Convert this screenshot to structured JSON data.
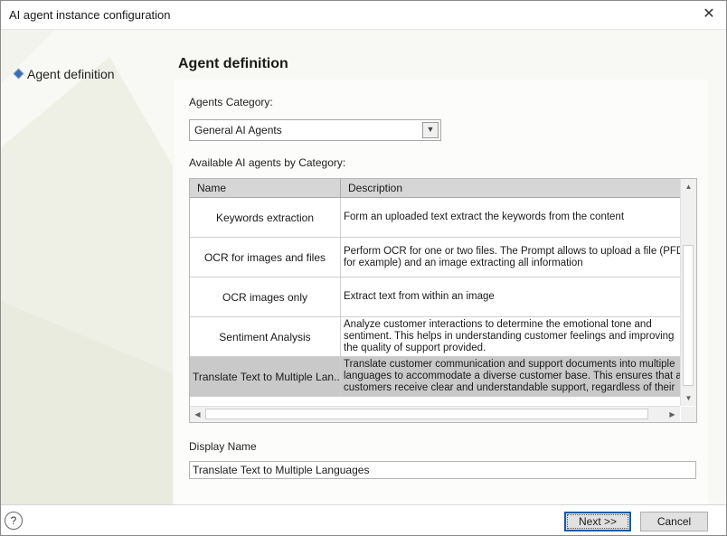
{
  "window": {
    "title": "AI agent instance configuration",
    "close_icon": "close-icon"
  },
  "nav": {
    "items": [
      {
        "label": "Agent definition",
        "icon": "diamond-bullet-icon"
      }
    ]
  },
  "main": {
    "section_title": "Agent definition",
    "category_label": "Agents Category:",
    "category_value": "General AI Agents",
    "grid_label": "Available AI agents by Category:",
    "grid": {
      "columns": [
        "Name",
        "Description"
      ],
      "rows": [
        {
          "name": "Keywords extraction",
          "description": [
            "Form an uploaded text extract the keywords from the content"
          ],
          "selected": false
        },
        {
          "name": "OCR for images and files",
          "description": [
            "Perform OCR for one or two files. The Prompt allows to upload a file (PFD",
            "for example) and an image extracting all information"
          ],
          "selected": false
        },
        {
          "name": "OCR images only",
          "description": [
            "Extract text from within an image"
          ],
          "selected": false
        },
        {
          "name": "Sentiment Analysis",
          "description": [
            "Analyze customer interactions to determine the emotional tone and",
            "sentiment. This helps in understanding customer feelings and improving",
            "the quality of support provided."
          ],
          "selected": false
        },
        {
          "name": "Translate Text to Multiple Lan...",
          "description": [
            "Translate customer communication and support documents into multiple",
            "languages to accommodate a diverse customer base. This ensures that al",
            "customers receive clear and understandable support, regardless of their"
          ],
          "selected": true
        }
      ]
    },
    "display_name_label": "Display Name",
    "display_name_value": "Translate Text to Multiple Languages"
  },
  "footer": {
    "help_label": "?",
    "next_label": "Next >>",
    "cancel_label": "Cancel"
  },
  "colors": {
    "selected_row": "#c9c9c9",
    "header": "#d6d6d6",
    "focus_border": "#0f5ea8",
    "bullet": "#3b6db3"
  }
}
